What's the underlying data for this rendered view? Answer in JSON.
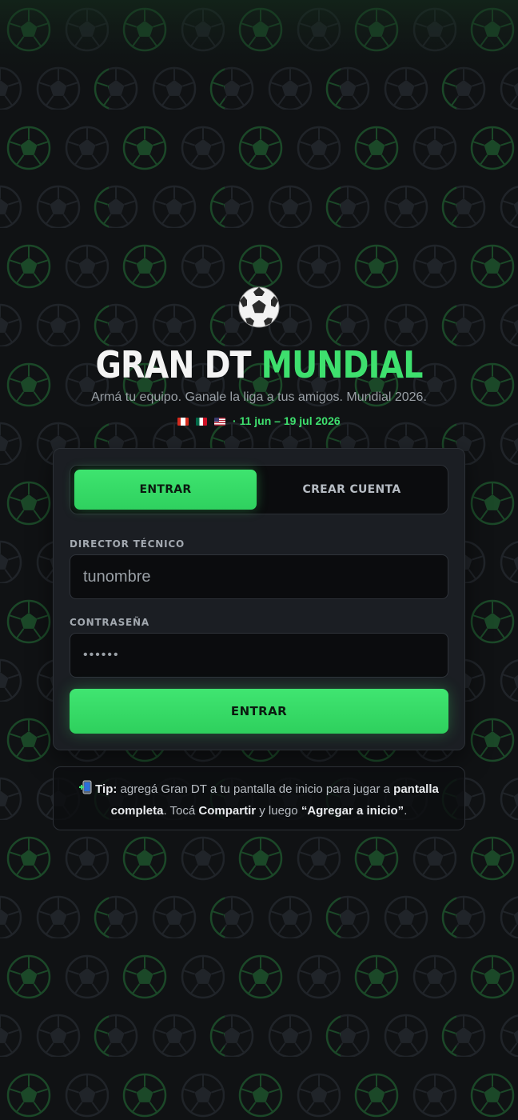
{
  "hero": {
    "icon": "soccer-ball-icon",
    "title_white": "GRAN DT",
    "title_green": "MUNDIAL",
    "tagline": "Armá tu equipo. Ganale la liga a tus amigos. Mundial 2026.",
    "flags": [
      "canada-flag",
      "mexico-flag",
      "usa-flag"
    ],
    "dates": "· 11 jun – 19 jul 2026"
  },
  "auth": {
    "tabs": [
      {
        "label": "ENTRAR",
        "active": true
      },
      {
        "label": "CREAR CUENTA",
        "active": false
      }
    ],
    "username_label": "DIRECTOR TÉCNICO",
    "username_placeholder": "tunombre",
    "password_label": "CONTRASEÑA",
    "password_value": "••••••",
    "submit_label": "ENTRAR"
  },
  "tip": {
    "icon": "phone-add-icon",
    "lead": "Tip:",
    "text_1": "agregá Gran DT a tu pantalla de inicio para jugar a",
    "bold_1": "pantalla completa",
    "text_2": ". Tocá",
    "bold_2": "Compartir",
    "text_3": "y luego",
    "bold_3": "“Agregar a inicio”",
    "text_4": "."
  },
  "colors": {
    "accent": "#3ee06e",
    "background": "#101214",
    "card": "#1b1e23",
    "input": "#0b0c0e"
  }
}
